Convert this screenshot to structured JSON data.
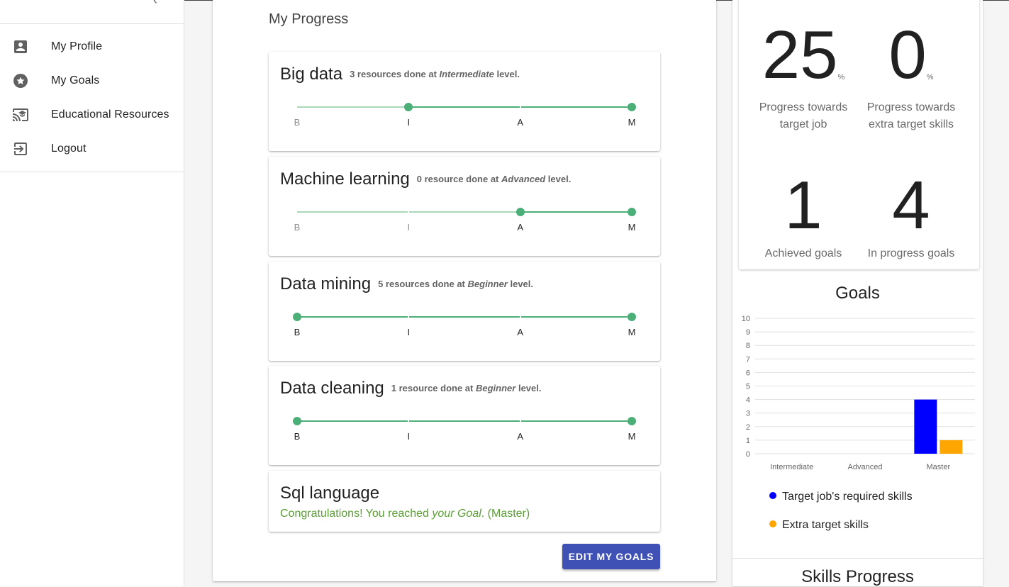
{
  "sidebar": {
    "items": [
      {
        "label": "My Profile",
        "icon": "account-box-icon"
      },
      {
        "label": "My Goals",
        "icon": "star-circle-icon"
      },
      {
        "label": "Educational Resources",
        "icon": "cast-for-education-icon"
      },
      {
        "label": "Logout",
        "icon": "exit-to-app-icon"
      }
    ]
  },
  "progress": {
    "title": "My Progress",
    "level_letters": [
      "B",
      "I",
      "A",
      "M"
    ],
    "skills": [
      {
        "name": "Big data",
        "meta_pre": "3 resources done at",
        "level_name": "Intermediate",
        "meta_post": "level.",
        "current_level": 1,
        "goal_level": 3
      },
      {
        "name": "Machine learning",
        "meta_pre": "0 resource done at",
        "level_name": "Advanced",
        "meta_post": "level.",
        "current_level": 2,
        "goal_level": 3
      },
      {
        "name": "Data mining",
        "meta_pre": "5 resources done at",
        "level_name": "Beginner",
        "meta_post": "level.",
        "current_level": 0,
        "goal_level": 3
      },
      {
        "name": "Data cleaning",
        "meta_pre": "1 resource done at",
        "level_name": "Beginner",
        "meta_post": "level.",
        "current_level": 0,
        "goal_level": 3
      }
    ],
    "completed": {
      "name": "Sql language",
      "msg_pre": "Congratulations! You reached",
      "msg_em": "your Goal",
      "msg_post": ". (Master)"
    },
    "edit_button": "EDIT MY GOALS"
  },
  "stats": {
    "target_job_pct": "25",
    "target_job_label_1": "Progress towards",
    "target_job_label_2": "target job",
    "extra_pct": "0",
    "extra_label_1": "Progress towards",
    "extra_label_2": "extra target skills",
    "pct_symbol": "%",
    "achieved": "1",
    "achieved_label": "Achieved goals",
    "in_progress": "4",
    "in_progress_label": "In progress goals"
  },
  "goals_chart_title": "Goals",
  "chart_data": {
    "type": "bar",
    "title": "Goals",
    "categories": [
      "Intermediate",
      "Advanced",
      "Master"
    ],
    "series": [
      {
        "name": "Target job's required skills",
        "values": [
          0,
          0,
          4
        ],
        "color": "#0000ff"
      },
      {
        "name": "Extra target skills",
        "values": [
          0,
          0,
          1
        ],
        "color": "#ffa500"
      }
    ],
    "ylim": [
      0,
      10
    ],
    "yticks": [
      0,
      1,
      2,
      3,
      4,
      5,
      6,
      7,
      8,
      9,
      10
    ],
    "grid": true,
    "legend": "bottom"
  },
  "skills_progress_title": "Skills Progress",
  "colors": {
    "accent": "#3f51b5",
    "progress_green": "#4caf78",
    "success_text": "#5a9e35"
  }
}
